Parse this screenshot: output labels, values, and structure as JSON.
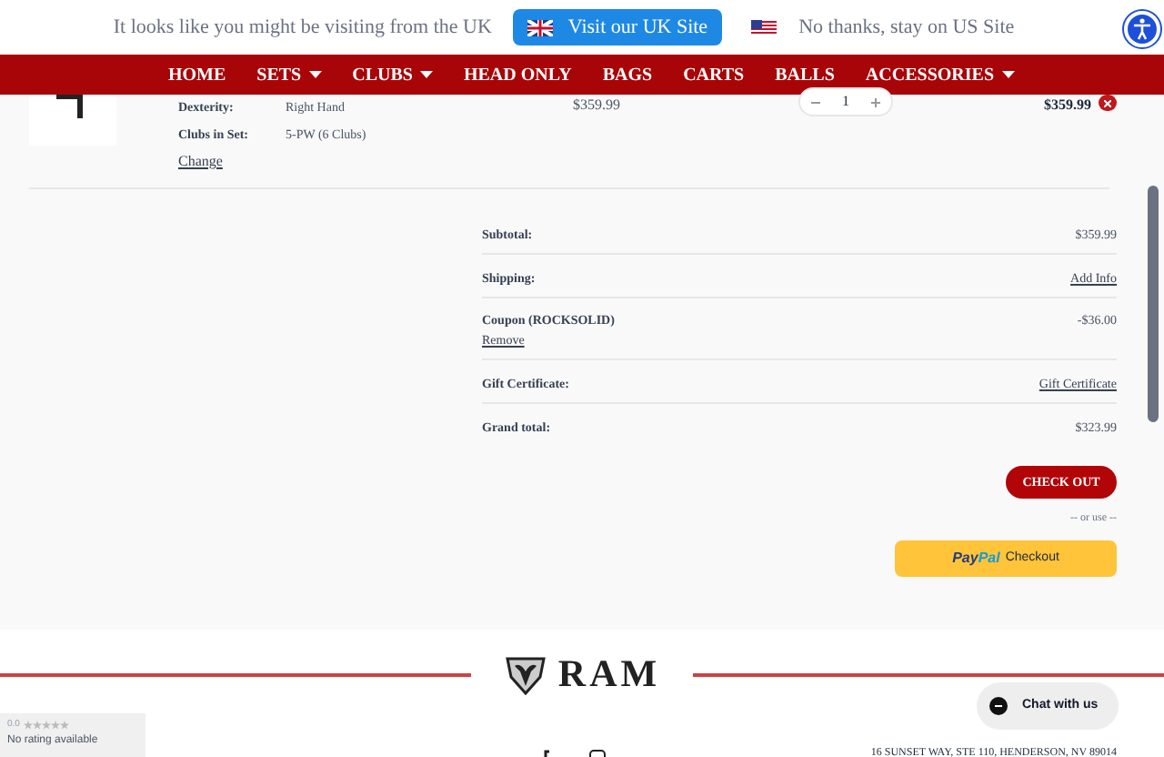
{
  "banner": {
    "message": "It looks like you might be visiting from the UK",
    "uk_button": "Visit our UK Site",
    "stay_link": "No thanks, stay on US Site"
  },
  "nav": [
    {
      "label": "HOME",
      "dropdown": false
    },
    {
      "label": "SETS",
      "dropdown": true
    },
    {
      "label": "CLUBS",
      "dropdown": true
    },
    {
      "label": "HEAD ONLY",
      "dropdown": false
    },
    {
      "label": "BAGS",
      "dropdown": false
    },
    {
      "label": "CARTS",
      "dropdown": false
    },
    {
      "label": "BALLS",
      "dropdown": false
    },
    {
      "label": "ACCESSORIES",
      "dropdown": true
    }
  ],
  "cart_item": {
    "specs": [
      {
        "label": "Dexterity:",
        "value": "Right Hand"
      },
      {
        "label": "Clubs in Set:",
        "value": "5-PW (6 Clubs)"
      }
    ],
    "change_link": "Change",
    "price": "$359.99",
    "quantity": "1",
    "total": "$359.99"
  },
  "summary": [
    {
      "kind": "text",
      "label": "Subtotal:",
      "value": "$359.99"
    },
    {
      "kind": "link",
      "label": "Shipping:",
      "value": "Add Info"
    },
    {
      "kind": "coupon",
      "label": "Coupon (ROCKSOLID)",
      "sublink": "Remove",
      "value": "-$36.00"
    },
    {
      "kind": "link",
      "label": "Gift Certificate:",
      "value": "Gift Certificate"
    },
    {
      "kind": "text",
      "label": "Grand total:",
      "value": "$323.99"
    }
  ],
  "checkout_button": "CHECK OUT",
  "or_use": "-- or use --",
  "paypal": {
    "brand_a": "Pay",
    "brand_b": "Pal",
    "label": "Checkout"
  },
  "footer": {
    "logo_text": "RAM",
    "address": "16 SUNSET WAY, STE 110, HENDERSON, NV 89014"
  },
  "rating_widget": {
    "score": "0.0",
    "stars": 0,
    "text": "No rating available"
  },
  "chat_button": "Chat with us"
}
